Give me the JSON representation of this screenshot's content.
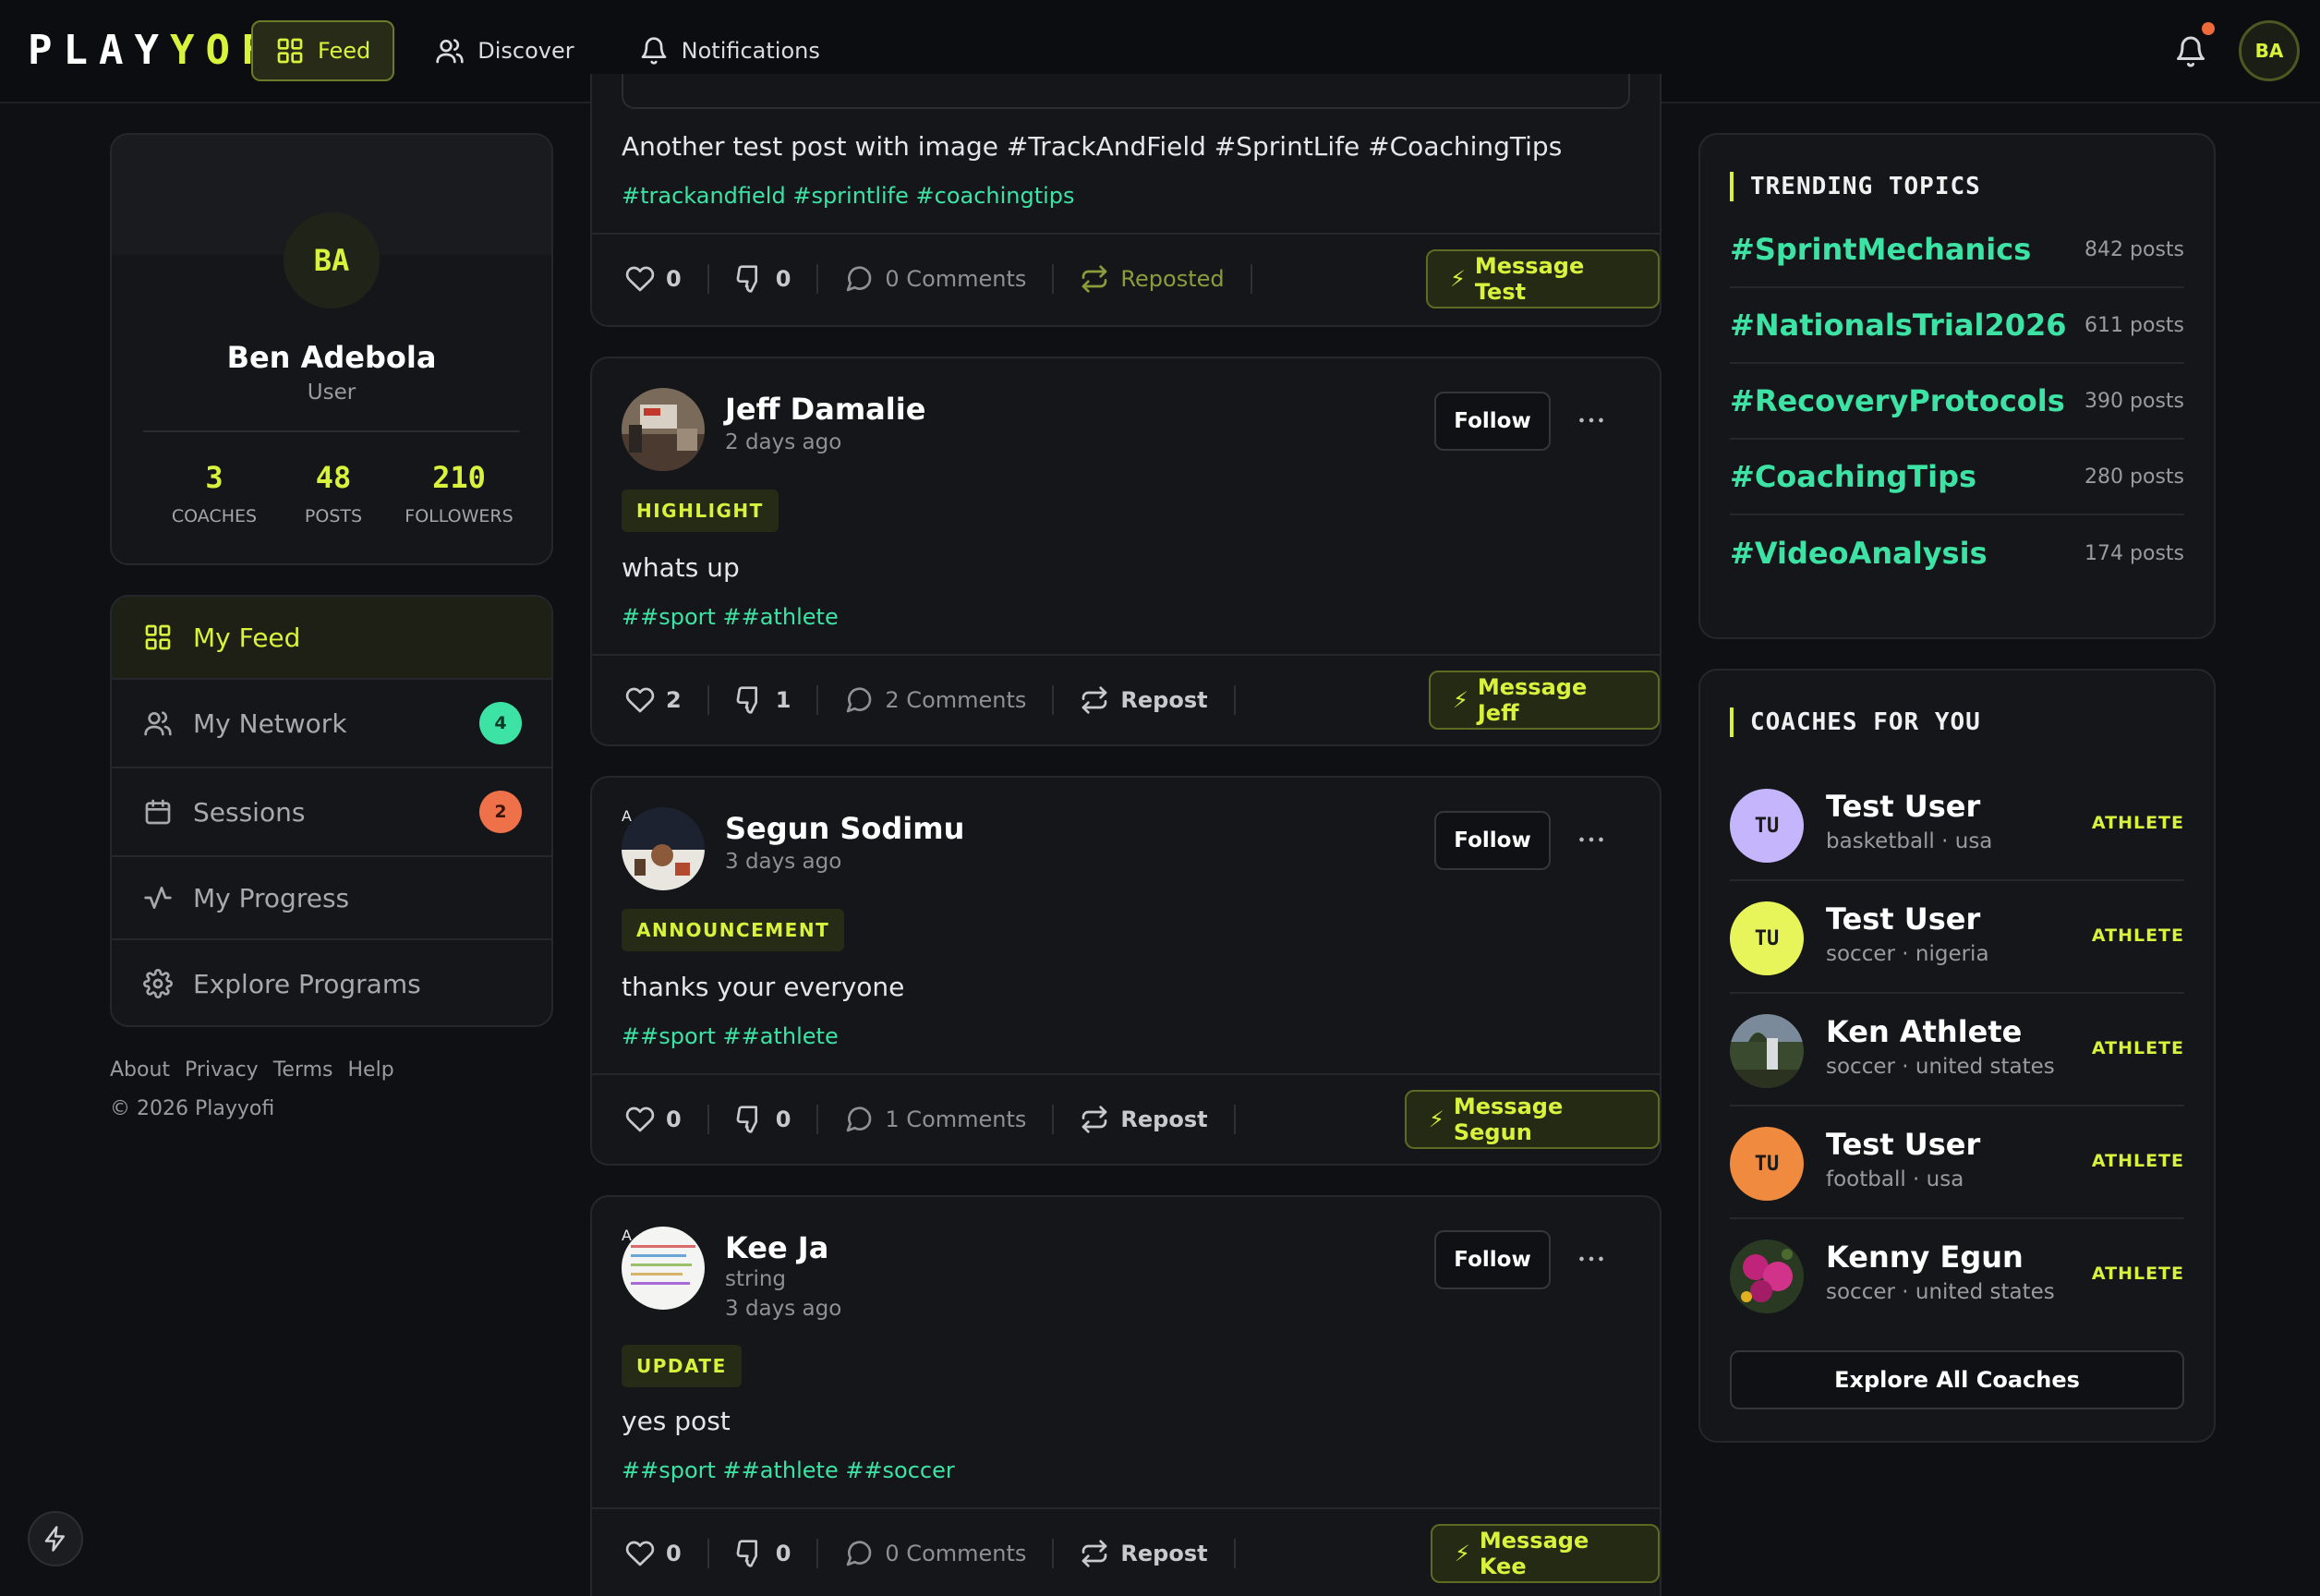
{
  "app": {
    "logo_part1": "PLAY",
    "logo_part2": "YOFI",
    "nav": [
      {
        "label": "Feed"
      },
      {
        "label": "Discover"
      },
      {
        "label": "Notifications"
      }
    ],
    "user_initials": "BA"
  },
  "profile": {
    "initials": "BA",
    "name": "Ben Adebola",
    "role": "User",
    "stats": [
      {
        "value": "3",
        "label": "COACHES"
      },
      {
        "value": "48",
        "label": "POSTS"
      },
      {
        "value": "210",
        "label": "FOLLOWERS"
      }
    ]
  },
  "menu": [
    {
      "label": "My Feed",
      "icon": "grid-icon"
    },
    {
      "label": "My Network",
      "icon": "users-icon",
      "badge": "4",
      "badge_color": "#3de3a5"
    },
    {
      "label": "Sessions",
      "icon": "calendar-icon",
      "badge": "2",
      "badge_color": "#ee7149"
    },
    {
      "label": "My Progress",
      "icon": "activity-icon"
    },
    {
      "label": "Explore Programs",
      "icon": "gear-icon"
    }
  ],
  "footer": {
    "links": [
      "About",
      "Privacy",
      "Terms",
      "Help"
    ],
    "copyright": "© 2026 Playyofi"
  },
  "posts": [
    {
      "text": "Another test post with image #TrackAndField #SprintLife #CoachingTips",
      "hashtags": "#trackandfield #sprintlife #coachingtips",
      "likes": "0",
      "dislikes": "0",
      "comments": "0 Comments",
      "repost": "Reposted",
      "message": "Message Test"
    },
    {
      "author": "Jeff Damalie",
      "time": "2 days ago",
      "tag": "HIGHLIGHT",
      "text": "whats up",
      "hashtags": "##sport ##athlete",
      "likes": "2",
      "dislikes": "1",
      "comments": "2 Comments",
      "repost": "Repost",
      "follow": "Follow",
      "message": "Message Jeff"
    },
    {
      "author": "Segun Sodimu",
      "time": "3 days ago",
      "tag": "ANNOUNCEMENT",
      "text": "thanks your everyone",
      "hashtags": "##sport ##athlete",
      "likes": "0",
      "dislikes": "0",
      "comments": "1 Comments",
      "repost": "Repost",
      "follow": "Follow",
      "message": "Message Segun",
      "avatar_badge": "A"
    },
    {
      "author": "Kee Ja",
      "subtitle": "string",
      "time": "3 days ago",
      "tag": "UPDATE",
      "text": "yes post",
      "hashtags": "##sport ##athlete ##soccer",
      "likes": "0",
      "dislikes": "0",
      "comments": "0 Comments",
      "repost": "Repost",
      "follow": "Follow",
      "message": "Message Kee",
      "avatar_badge": "A"
    }
  ],
  "trending": {
    "title": "TRENDING TOPICS",
    "items": [
      {
        "tag": "#SprintMechanics",
        "count": "842 posts"
      },
      {
        "tag": "#NationalsTrial2026",
        "count": "611 posts"
      },
      {
        "tag": "#RecoveryProtocols",
        "count": "390 posts"
      },
      {
        "tag": "#CoachingTips",
        "count": "280 posts"
      },
      {
        "tag": "#VideoAnalysis",
        "count": "174 posts"
      }
    ]
  },
  "coaches": {
    "title": "COACHES FOR YOU",
    "items": [
      {
        "initials": "TU",
        "name": "Test User",
        "meta": "basketball · usa",
        "role": "ATHLETE",
        "color": "#c4b5fd"
      },
      {
        "initials": "TU",
        "name": "Test User",
        "meta": "soccer · nigeria",
        "role": "ATHLETE",
        "color": "#e8f55a"
      },
      {
        "initials": "",
        "name": "Ken Athlete",
        "meta": "soccer · united states",
        "role": "ATHLETE",
        "color": "#6b7a5a"
      },
      {
        "initials": "TU",
        "name": "Test User",
        "meta": "football · usa",
        "role": "ATHLETE",
        "color": "#f08a3e"
      },
      {
        "initials": "",
        "name": "Kenny Egun",
        "meta": "soccer · united states",
        "role": "ATHLETE",
        "color": "#a0206a"
      }
    ],
    "explore_label": "Explore All Coaches"
  }
}
